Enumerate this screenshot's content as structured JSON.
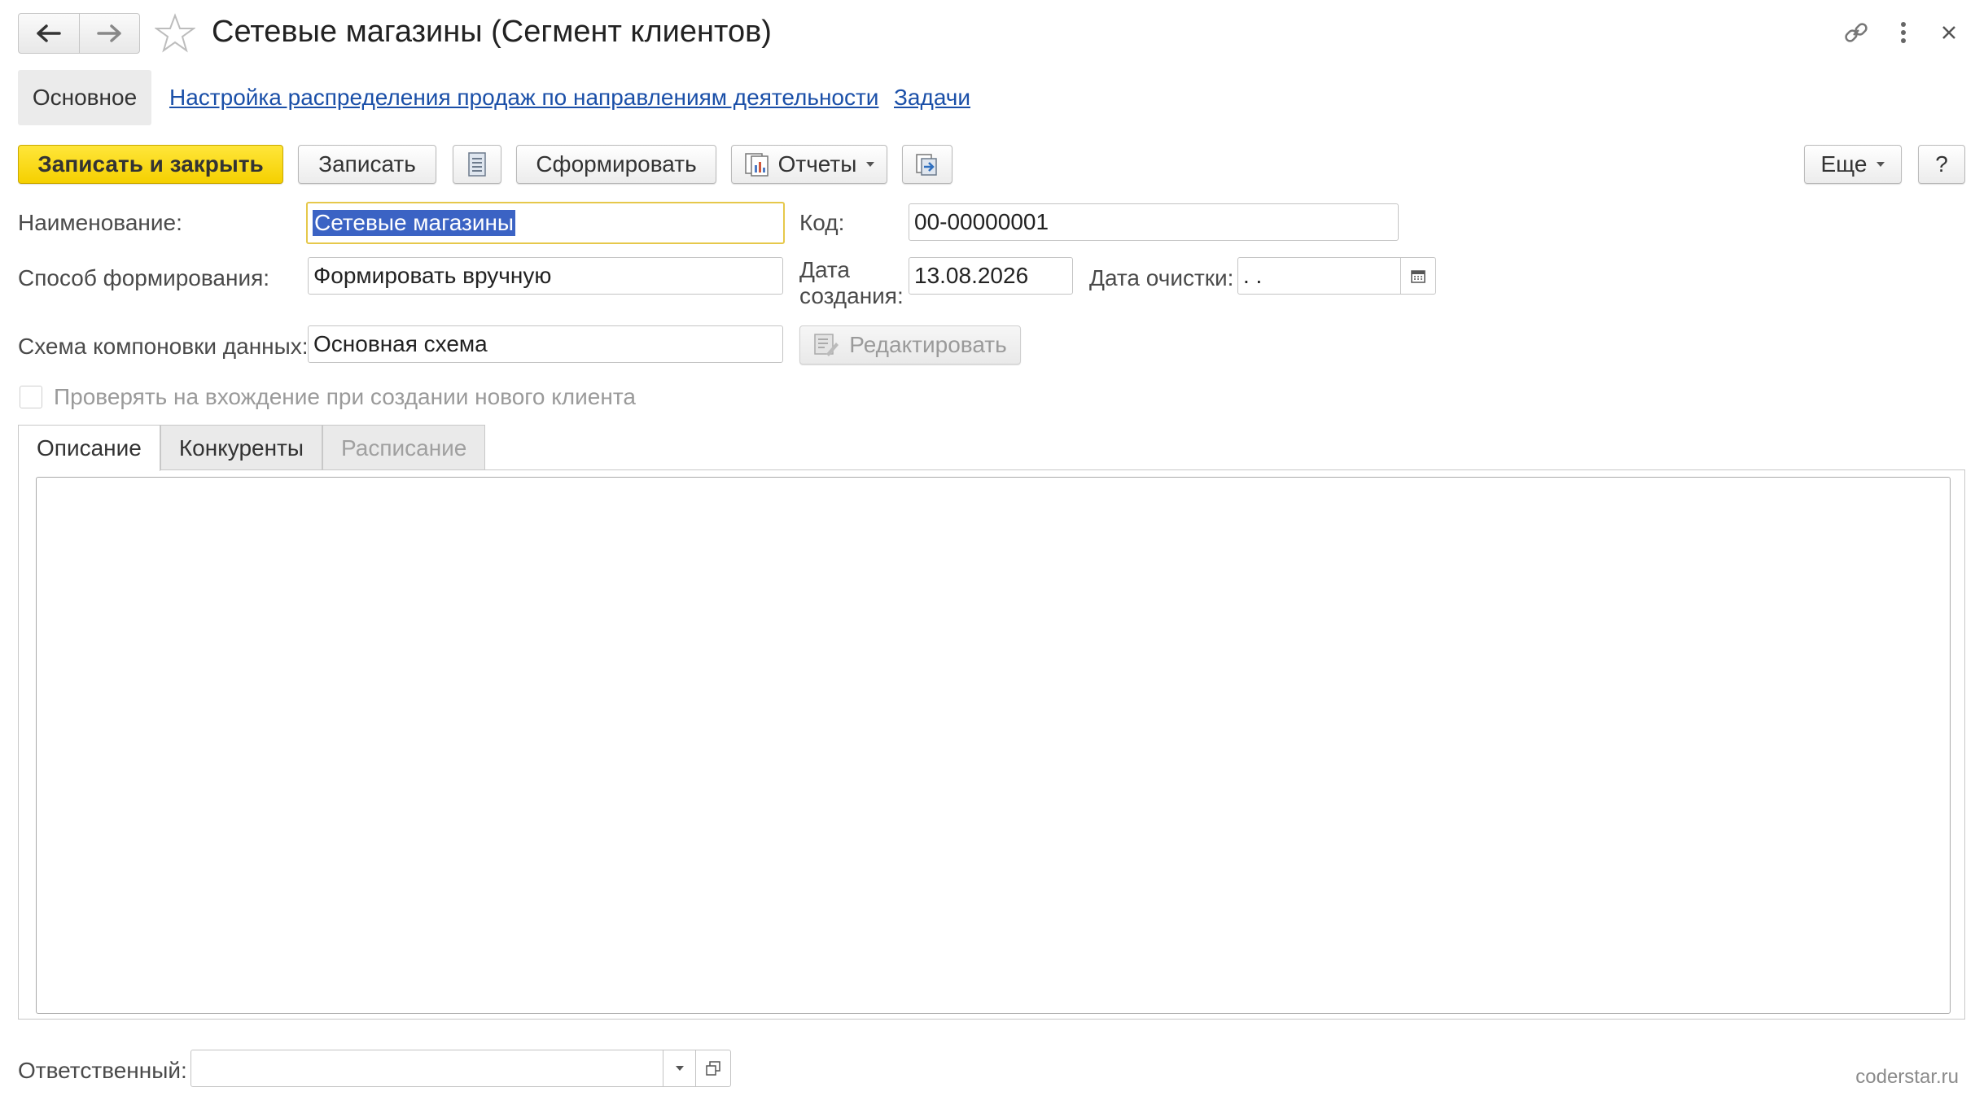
{
  "window": {
    "title": "Сетевые магазины (Сегмент клиентов)"
  },
  "sections": {
    "main": "Основное",
    "link_sales": "Настройка распределения продаж по направлениям деятельности",
    "link_tasks": "Задачи"
  },
  "toolbar": {
    "save_close": "Записать и закрыть",
    "save": "Записать",
    "generate": "Сформировать",
    "reports": "Отчеты",
    "more": "Еще",
    "help": "?"
  },
  "form": {
    "name_label": "Наименование:",
    "name_value": "Сетевые магазины",
    "code_label": "Код:",
    "code_value": "00-00000001",
    "method_label": "Способ формирования:",
    "method_value": "Формировать вручную",
    "created_label_1": "Дата",
    "created_label_2": "создания:",
    "created_value": "13.08.2026",
    "clear_label": "Дата очистки:",
    "clear_value": " .  .",
    "schema_label": "Схема компоновки данных:",
    "schema_value": "Основная схема",
    "edit_button": "Редактировать",
    "check_label": "Проверять на вхождение при создании нового клиента",
    "responsible_label": "Ответственный:",
    "responsible_value": ""
  },
  "tabs": [
    {
      "label": "Описание"
    },
    {
      "label": "Конкуренты"
    },
    {
      "label": "Расписание"
    }
  ],
  "watermark": "coderstar.ru"
}
